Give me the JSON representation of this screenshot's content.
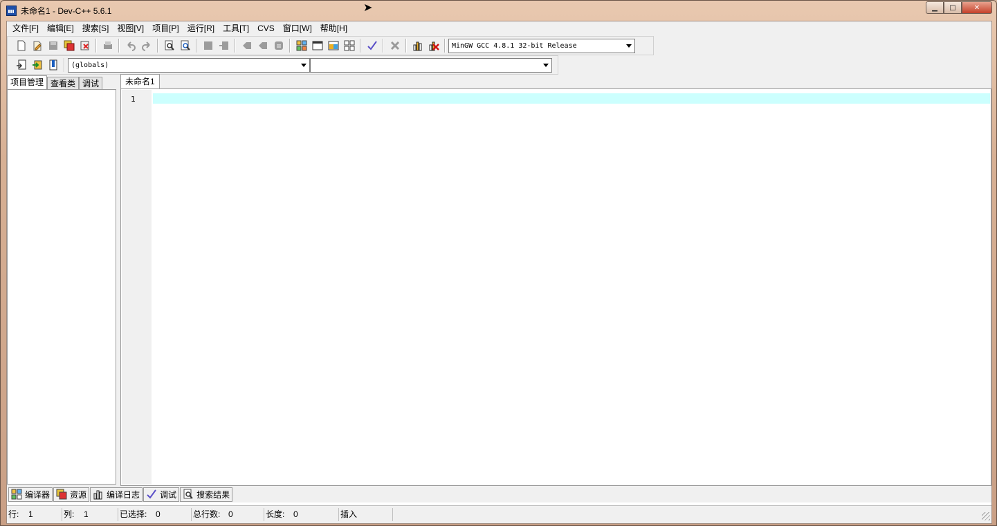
{
  "window": {
    "title": "未命名1 - Dev-C++ 5.6.1",
    "min_glyph": "▁",
    "max_glyph": "□",
    "close_glyph": "✕"
  },
  "menu": [
    "文件[F]",
    "编辑[E]",
    "搜索[S]",
    "视图[V]",
    "项目[P]",
    "运行[R]",
    "工具[T]",
    "CVS",
    "窗口[W]",
    "帮助[H]"
  ],
  "toolbar": {
    "compiler_select": "MinGW GCC 4.8.1 32-bit Release"
  },
  "toolbar2": {
    "scope_select": "(globals)",
    "member_select": ""
  },
  "left_tabs": [
    "项目管理",
    "查看类",
    "调试"
  ],
  "editor": {
    "tabs": [
      "未命名1"
    ],
    "line_numbers": [
      "1"
    ],
    "active_line_color": "#ccfffe"
  },
  "bottom_tabs": [
    "编译器",
    "资源",
    "编译日志",
    "调试",
    "搜索结果"
  ],
  "status": {
    "row_label": "行:",
    "row_value": "1",
    "col_label": "列:",
    "col_value": "1",
    "sel_label": "已选择:",
    "sel_value": "0",
    "total_label": "总行数:",
    "total_value": "0",
    "len_label": "长度:",
    "len_value": "0",
    "mode": "插入"
  }
}
